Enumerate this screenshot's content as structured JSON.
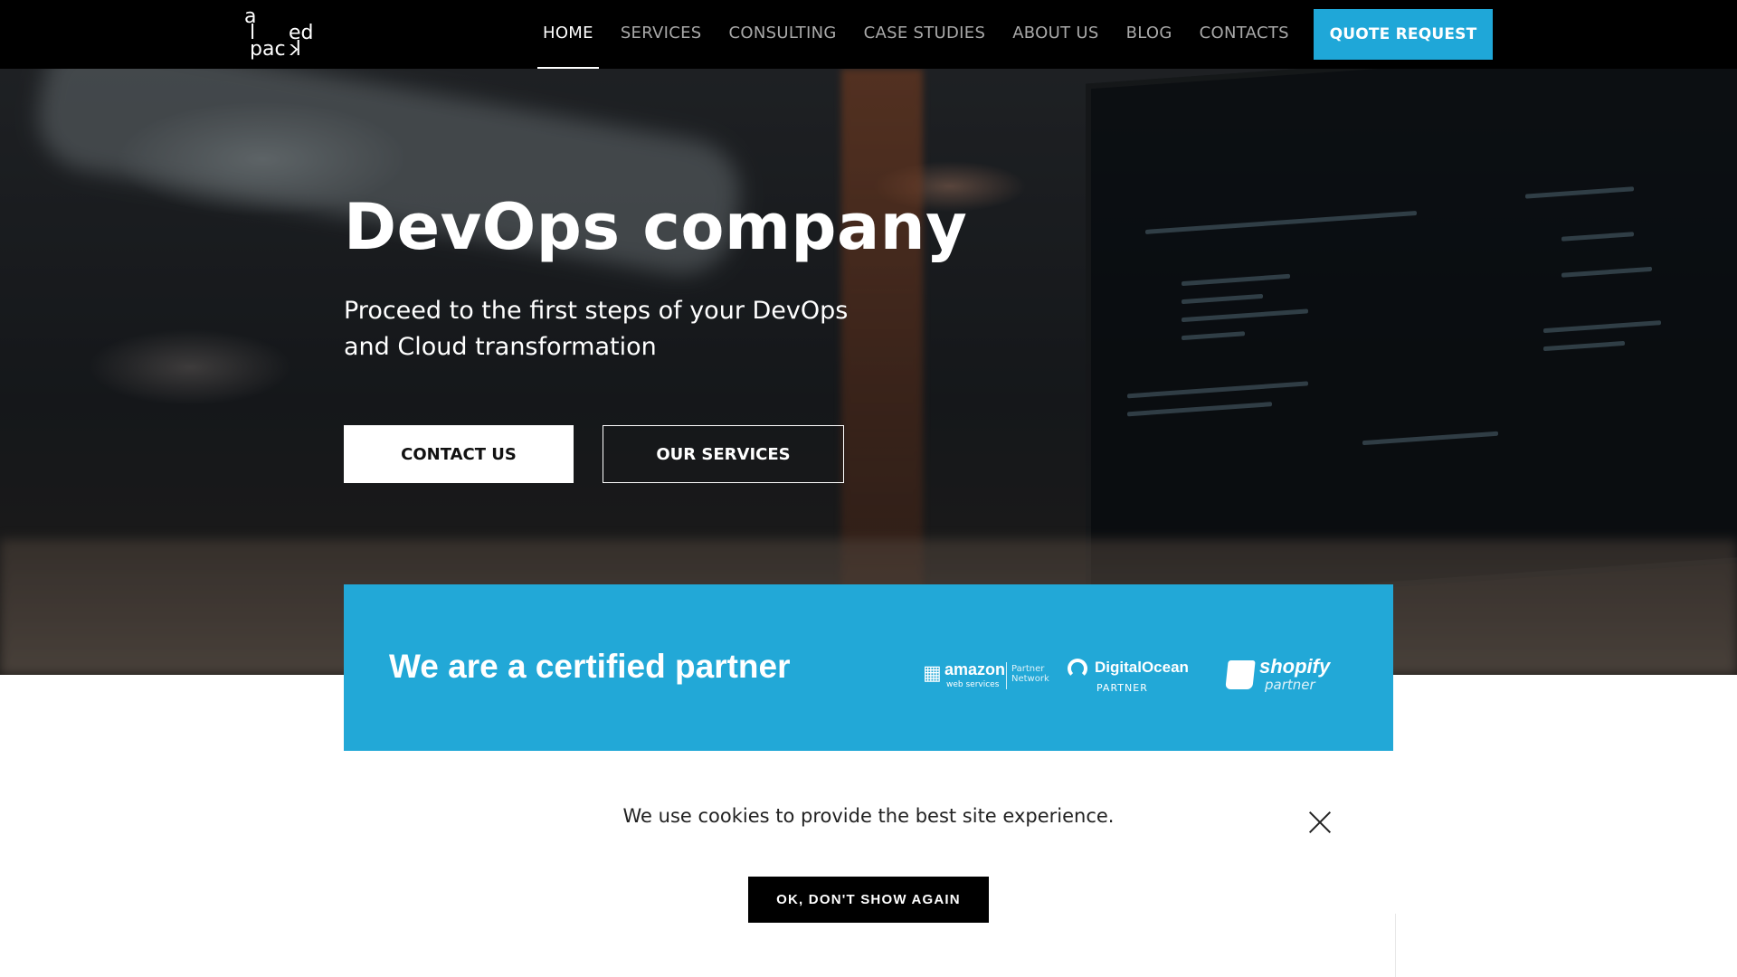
{
  "brand": {
    "logo_letters": [
      "a",
      "l",
      "ed",
      "pac",
      "k"
    ]
  },
  "nav": {
    "items": [
      {
        "label": "HOME",
        "active": true
      },
      {
        "label": "SERVICES",
        "active": false
      },
      {
        "label": "CONSULTING",
        "active": false
      },
      {
        "label": "CASE STUDIES",
        "active": false
      },
      {
        "label": "ABOUT US",
        "active": false
      },
      {
        "label": "BLOG",
        "active": false
      },
      {
        "label": "CONTACTS",
        "active": false
      }
    ],
    "quote_label": "QUOTE REQUEST"
  },
  "hero": {
    "title": "DevOps company",
    "subtitle": "Proceed to the first steps of your DevOps and Cloud transformation",
    "contact_label": "CONTACT US",
    "services_label": "OUR SERVICES"
  },
  "partner": {
    "title": "We are a certified partner",
    "aws_name": "amazon",
    "aws_sub": "web services",
    "aws_network": "Partner Network",
    "do_name": "DigitalOcean",
    "do_sub": "PARTNER",
    "shopify_name": "shopify",
    "shopify_sub": "partner"
  },
  "cookie": {
    "message": "We use cookies to provide the best site experience.",
    "button_label": "OK, DON'T SHOW AGAIN"
  },
  "colors": {
    "accent": "#22a8d7",
    "nav_bg": "#000000"
  }
}
